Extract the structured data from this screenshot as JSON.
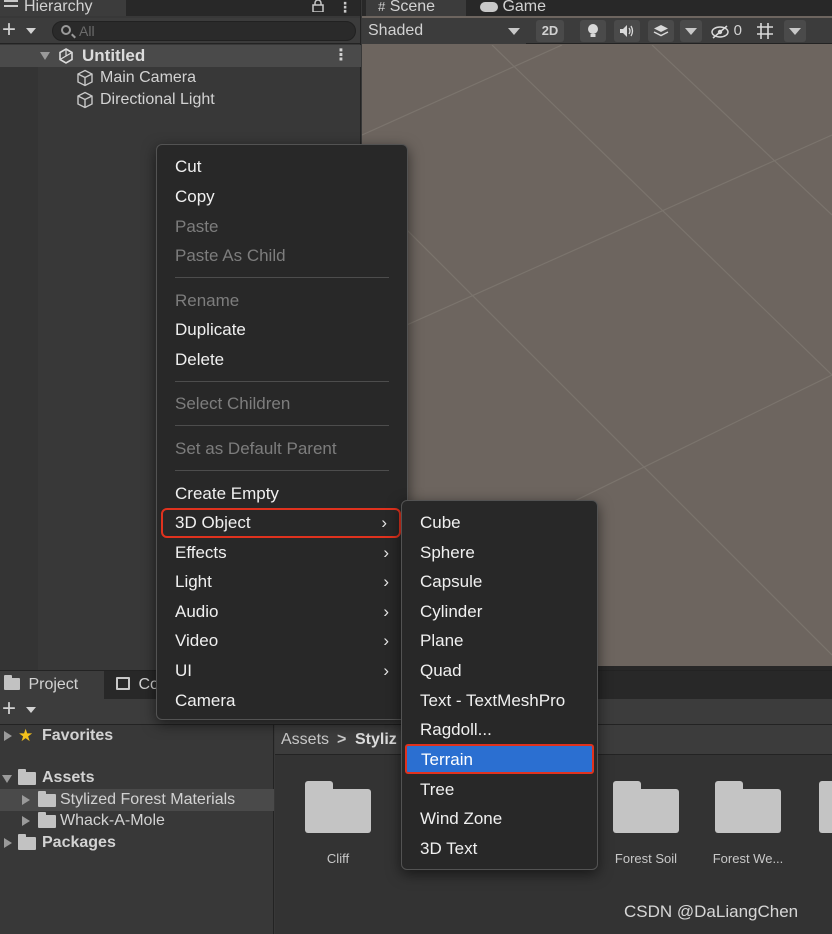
{
  "hierarchy": {
    "tab_label": "Hierarchy",
    "search_placeholder": "All",
    "scene_name": "Untitled",
    "items": [
      {
        "label": "Main Camera"
      },
      {
        "label": "Directional Light"
      }
    ]
  },
  "scene": {
    "tabs": [
      {
        "label": "Scene",
        "icon": "grid-icon"
      },
      {
        "label": "Game",
        "icon": "gamepad-icon"
      }
    ],
    "shading_mode": "Shaded",
    "toggle_2d": "2D",
    "hidden_count": "0"
  },
  "context_menu": {
    "items": [
      {
        "label": "Cut",
        "enabled": true
      },
      {
        "label": "Copy",
        "enabled": true
      },
      {
        "label": "Paste",
        "enabled": false
      },
      {
        "label": "Paste As Child",
        "enabled": false
      },
      {
        "label": "Rename",
        "enabled": false
      },
      {
        "label": "Duplicate",
        "enabled": true
      },
      {
        "label": "Delete",
        "enabled": true
      },
      {
        "label": "Select Children",
        "enabled": false
      },
      {
        "label": "Set as Default Parent",
        "enabled": false
      },
      {
        "label": "Create Empty",
        "enabled": true
      },
      {
        "label": "3D Object",
        "enabled": true,
        "submenu": true,
        "highlighted": true
      },
      {
        "label": "Effects",
        "enabled": true,
        "submenu": true
      },
      {
        "label": "Light",
        "enabled": true,
        "submenu": true
      },
      {
        "label": "Audio",
        "enabled": true,
        "submenu": true
      },
      {
        "label": "Video",
        "enabled": true,
        "submenu": true
      },
      {
        "label": "UI",
        "enabled": true,
        "submenu": true
      },
      {
        "label": "Camera",
        "enabled": true
      }
    ]
  },
  "submenu_3d_object": {
    "items": [
      {
        "label": "Cube"
      },
      {
        "label": "Sphere"
      },
      {
        "label": "Capsule"
      },
      {
        "label": "Cylinder"
      },
      {
        "label": "Plane"
      },
      {
        "label": "Quad"
      },
      {
        "label": "Text - TextMeshPro"
      },
      {
        "label": "Ragdoll..."
      },
      {
        "label": "Terrain",
        "selected": true
      },
      {
        "label": "Tree"
      },
      {
        "label": "Wind Zone"
      },
      {
        "label": "3D Text"
      }
    ]
  },
  "project": {
    "tabs": [
      {
        "label": "Project"
      },
      {
        "label": "Co"
      }
    ],
    "tree": [
      {
        "label": "Favorites"
      },
      {
        "label": "Assets"
      },
      {
        "label": "Stylized Forest Materials"
      },
      {
        "label": "Whack-A-Mole"
      },
      {
        "label": "Packages"
      }
    ],
    "breadcrumb": [
      "Assets",
      "Styliz"
    ],
    "folders": [
      {
        "label": "Cliff"
      },
      {
        "label": "Forest Soil"
      },
      {
        "label": "Forest We..."
      }
    ]
  },
  "watermark": "CSDN @DaLiangChen",
  "colors": {
    "menu_bg": "#282828",
    "highlight_outline": "#e0321e",
    "selection_blue": "#2b6fd1",
    "scene_bg": "#6d655f"
  }
}
